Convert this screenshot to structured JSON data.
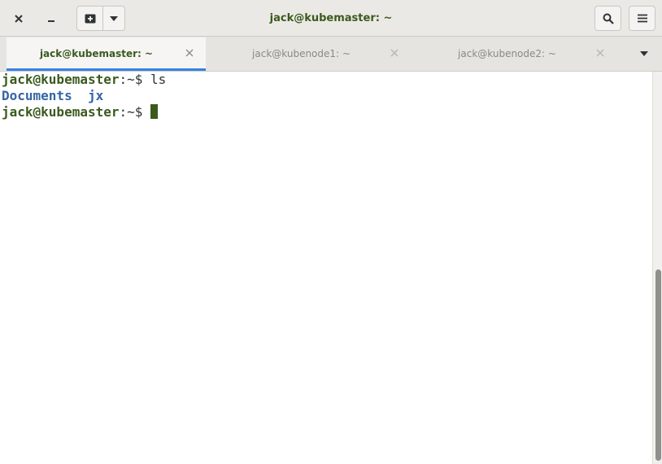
{
  "window": {
    "title": "jack@kubemaster: ~"
  },
  "icons": {
    "close": "close-icon",
    "minimize": "minimize-icon",
    "new_tab": "new-tab-icon",
    "new_tab_menu": "chevron-down-icon",
    "search": "search-icon",
    "menu": "hamburger-menu-icon",
    "tab_close": "close-icon",
    "tab_list": "chevron-down-icon"
  },
  "tabs": [
    {
      "label": "jack@kubemaster: ~",
      "active": true
    },
    {
      "label": "jack@kubenode1: ~",
      "active": false
    },
    {
      "label": "jack@kubenode2: ~",
      "active": false
    }
  ],
  "terminal": {
    "line1": {
      "prompt": "jack@kubemaster",
      "path": ":~$ ",
      "command": "ls"
    },
    "line2": {
      "dir1": "Documents",
      "sep": "  ",
      "dir2": "jx"
    },
    "line3": {
      "prompt": "jack@kubemaster",
      "path": ":~$ "
    }
  },
  "colors": {
    "accent": "#3584e4",
    "prompt": "#3a5a1e",
    "directory": "#3465a4"
  }
}
